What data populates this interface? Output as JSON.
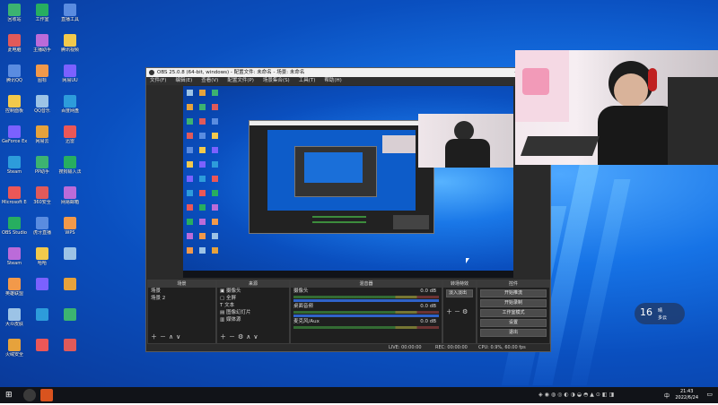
{
  "desktop": {
    "icons_col1": [
      "回收站",
      "此电脑",
      "腾讯QQ",
      "控制面板",
      "GeForce Experience",
      "Steam",
      "Microsoft Edge",
      "OBS Studio",
      "Steam",
      "英雄联盟",
      "大众皮肤",
      "火绒安全"
    ],
    "icons_col2": [
      "工作室",
      "主播助手",
      "图标",
      "QQ音乐",
      "网易云",
      "PP助手",
      "360安全",
      "虎牙直播",
      "哈哈",
      "",
      "",
      ""
    ],
    "icons_col3": [
      "直播工具",
      "腾讯视频",
      "网易UU",
      "百度网盘",
      "迅雷",
      "搜狗输入法",
      "网易邮箱",
      "WPS",
      "",
      "",
      "",
      ""
    ]
  },
  "obs": {
    "title": "OBS 25.0.8 (64-bit, windows) - 配置文件: 未命名 - 场景: 未命名",
    "menu": [
      "文件(F)",
      "编辑(E)",
      "查看(V)",
      "配置文件(P)",
      "场景集合(S)",
      "工具(T)",
      "帮助(H)"
    ],
    "docks": {
      "scenes": {
        "header": "场景",
        "items": [
          "场景",
          "场景 2"
        ]
      },
      "sources": {
        "header": "来源",
        "items": [
          "摄像头",
          "全屏",
          "文本",
          "图像幻灯片",
          "媒体源"
        ]
      },
      "mixer": {
        "header": "混音器",
        "channels": [
          {
            "name": "摄像头",
            "db": "0.0 dB"
          },
          {
            "name": "桌面音频",
            "db": "0.0 dB"
          },
          {
            "name": "麦克风/Aux",
            "db": "0.0 dB"
          }
        ]
      },
      "transitions": {
        "header": "转场特效",
        "type": "淡入淡出",
        "duration_label": "时长",
        "duration": "300 ms"
      },
      "controls": {
        "header": "控件",
        "buttons": [
          "开始推流",
          "开始录制",
          "工作室模式",
          "设置",
          "退出"
        ]
      }
    },
    "status": {
      "live": "LIVE: 00:00:00",
      "rec": "REC: 00:00:00",
      "cpu": "CPU: 0.9%, 60.00 fps"
    }
  },
  "widget": {
    "temperature": "16",
    "line1": "晴",
    "line2": "多云"
  },
  "taskbar": {
    "time": "21:43",
    "date": "2022/6/24",
    "lang": "中"
  },
  "colors": {
    "desktop_blue": "#0a4fbf",
    "obs_dark": "#2a2a2a",
    "taskbar": "#111318"
  }
}
